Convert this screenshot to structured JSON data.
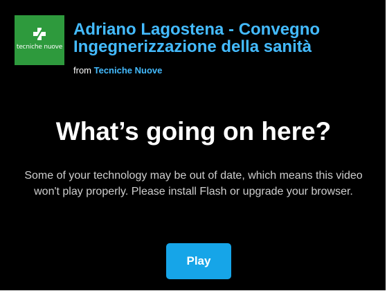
{
  "video": {
    "title": "Adriano Lagostena - Convegno Ingegnerizzazione della sanità",
    "from_prefix": "from",
    "publisher": "Tecniche Nuove",
    "logo_text": "tecniche nuove"
  },
  "notice": {
    "heading": "What’s going on here?",
    "message": "Some of your technology may be out of date, which means this video won't play properly. Please install Flash or upgrade your browser.",
    "play_label": "Play"
  },
  "colors": {
    "background": "#000000",
    "accent_text": "#44bbff",
    "button": "#16a5e8",
    "logo_green": "#2e9a3d"
  }
}
